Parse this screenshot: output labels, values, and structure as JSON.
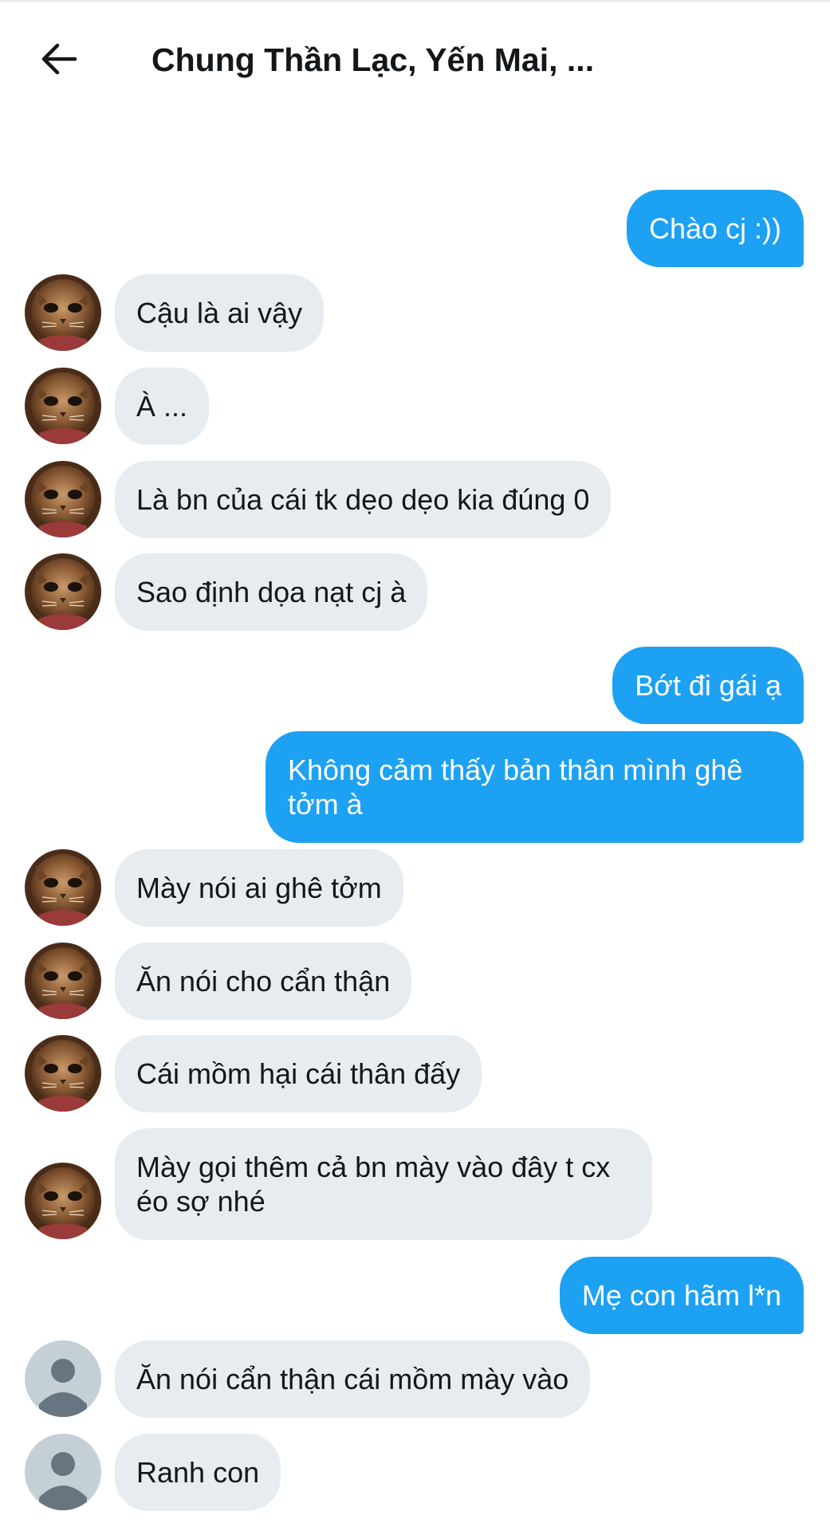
{
  "header": {
    "title": "Chung Thần Lạc, Yến Mai, ...",
    "back_icon": "arrow-left-icon"
  },
  "colors": {
    "outgoing": "#1da1f2",
    "incoming": "#e6ecf0",
    "text": "#14171a"
  },
  "messages": [
    {
      "dir": "out",
      "text": "Chào cj :))"
    },
    {
      "dir": "in",
      "text": "Cậu là ai vậy",
      "avatar": "cat-avatar"
    },
    {
      "dir": "in",
      "text": "À ...",
      "avatar": "cat-avatar"
    },
    {
      "dir": "in",
      "text": "Là bn của cái tk dẹo dẹo kia đúng 0",
      "avatar": "cat-avatar"
    },
    {
      "dir": "in",
      "text": "Sao định dọa nạt cj à",
      "avatar": "cat-avatar"
    },
    {
      "dir": "out",
      "text": "Bớt đi gái ạ"
    },
    {
      "dir": "out",
      "text": "Không cảm thấy bản thân mình ghê tởm à"
    },
    {
      "dir": "in",
      "text": "Mày nói ai ghê tởm",
      "avatar": "cat-avatar"
    },
    {
      "dir": "in",
      "text": "Ăn nói cho cẩn thận",
      "avatar": "cat-avatar"
    },
    {
      "dir": "in",
      "text": "Cái mồm hại cái thân đấy",
      "avatar": "cat-avatar"
    },
    {
      "dir": "in",
      "text": "Mày gọi thêm cả bn mày vào đây t cx éo sợ nhé",
      "avatar": "cat-avatar"
    },
    {
      "dir": "out",
      "text": "Mẹ con hãm l*n"
    },
    {
      "dir": "in",
      "text": "Ăn nói cẩn thận cái mồm mày vào",
      "avatar": "default-user-avatar"
    },
    {
      "dir": "in",
      "text": "Ranh con",
      "avatar": "default-user-avatar"
    }
  ]
}
